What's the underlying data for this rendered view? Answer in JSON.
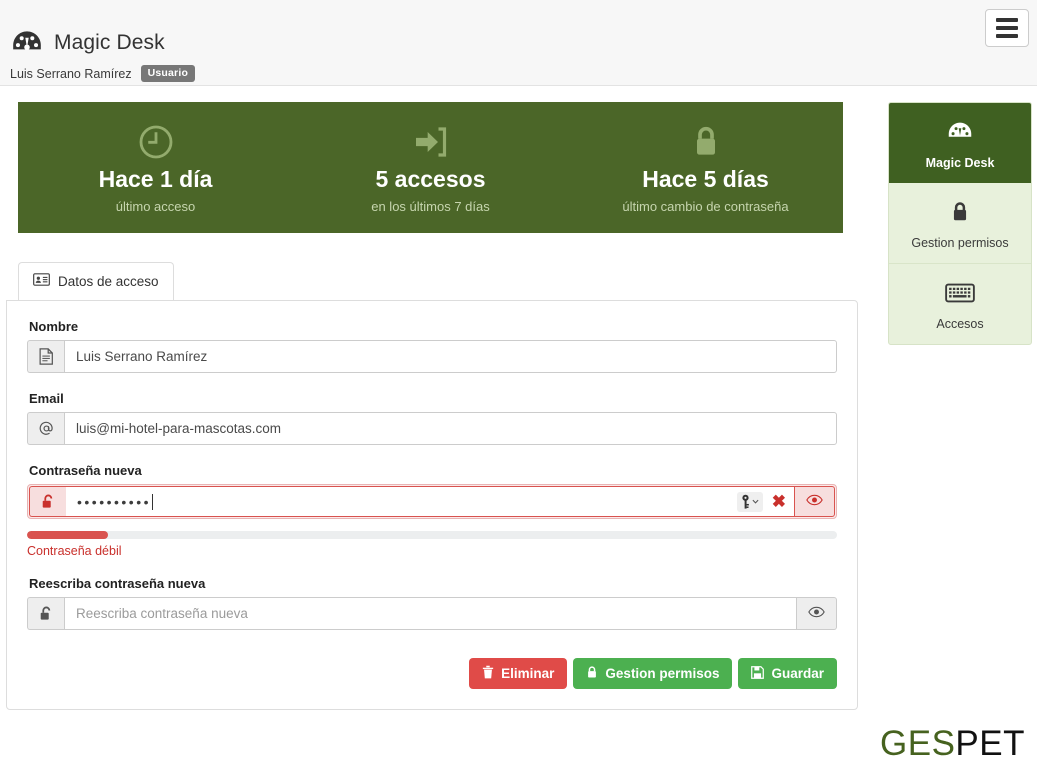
{
  "header": {
    "app_title": "Magic Desk",
    "logo_icon": "dashboard-gauge-icon",
    "user_name": "Luis Serrano Ramírez",
    "user_role_badge": "Usuario",
    "menu_icon": "hamburger-menu-icon"
  },
  "stats": {
    "banner_color": "#4b6628",
    "items": [
      {
        "icon": "clock-icon",
        "value": "Hace 1 día",
        "label": "último acceso"
      },
      {
        "icon": "sign-in-arrow-icon",
        "value": "5 accesos",
        "label": "en los últimos 7 días"
      },
      {
        "icon": "lock-icon",
        "value": "Hace 5 días",
        "label": "último cambio de contraseña"
      }
    ]
  },
  "sidebar": {
    "items": [
      {
        "icon": "dashboard-gauge-icon",
        "label": "Magic Desk",
        "active": true
      },
      {
        "icon": "lock-icon",
        "label": "Gestion permisos",
        "active": false
      },
      {
        "icon": "keyboard-icon",
        "label": "Accesos",
        "active": false
      }
    ]
  },
  "tabs": [
    {
      "icon": "id-card-icon",
      "label": "Datos de acceso",
      "active": true
    }
  ],
  "form": {
    "name": {
      "label": "Nombre",
      "icon": "file-text-icon",
      "value": "Luis Serrano Ramírez"
    },
    "email": {
      "label": "Email",
      "icon": "at-sign-icon",
      "value": "luis@mi-hotel-para-mascotas.com"
    },
    "new_password": {
      "label": "Contraseña nueva",
      "icon": "unlock-icon",
      "value": "••••••••••",
      "key_icon": "key-icon",
      "chevron_icon": "chevron-down-icon",
      "clear_icon": "✖",
      "eye_icon": "eye-icon",
      "state_color": "#d9534f"
    },
    "strength": {
      "percent": 10,
      "text": "Contraseña débil",
      "color": "#d9534f"
    },
    "repeat_password": {
      "label": "Reescriba contraseña nueva",
      "icon": "unlock-icon",
      "placeholder": "Reescriba contraseña nueva",
      "value": "",
      "eye_icon": "eye-icon"
    }
  },
  "buttons": [
    {
      "label": "Eliminar",
      "icon": "trash-icon",
      "style": "danger",
      "color": "#e04b48"
    },
    {
      "label": "Gestion permisos",
      "icon": "lock-icon",
      "style": "success",
      "color": "#4cb050"
    },
    {
      "label": "Guardar",
      "icon": "save-floppy-icon",
      "style": "success",
      "color": "#4cb050"
    }
  ],
  "footer": {
    "logo_part1": "GES",
    "logo_part2": "PET",
    "logo_part1_color": "#46621f",
    "logo_part2_color": "#111111"
  }
}
